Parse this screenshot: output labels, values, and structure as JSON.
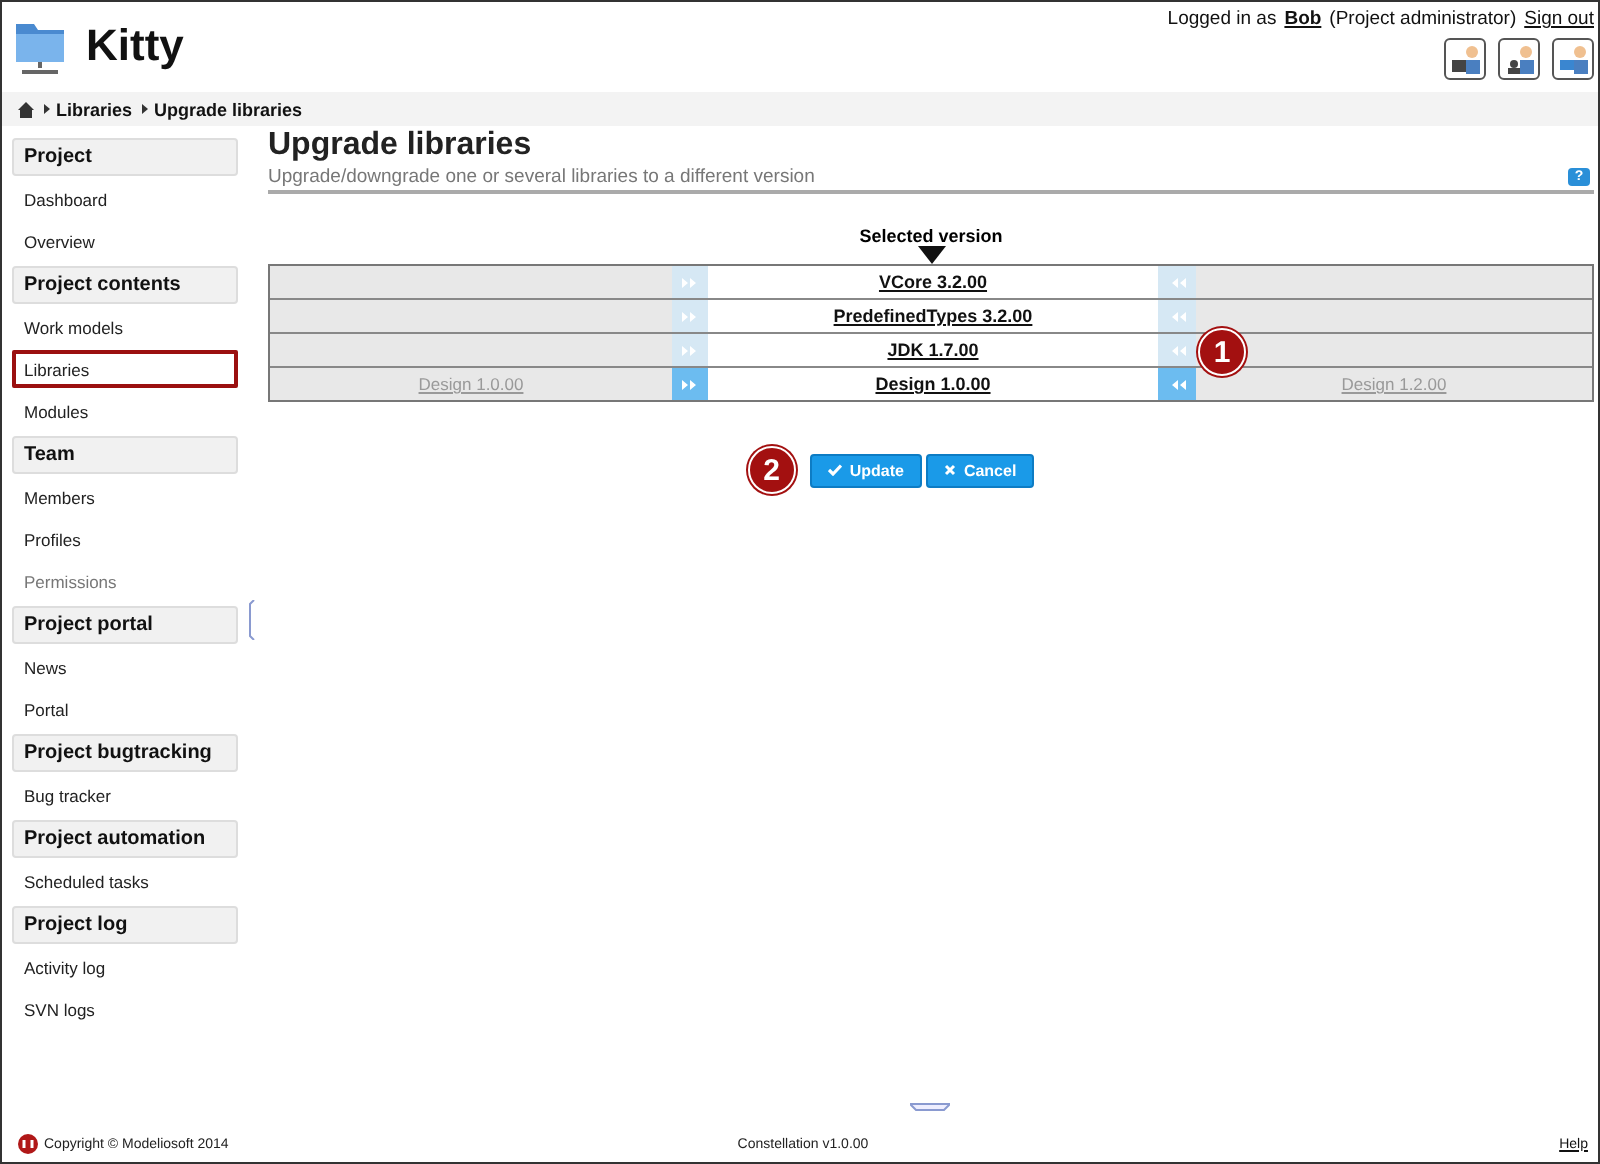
{
  "app": {
    "title": "Kitty"
  },
  "user": {
    "prefix": "Logged in as",
    "name": "Bob",
    "role": "(Project administrator)",
    "sign_out": "Sign out"
  },
  "breadcrumb": [
    "Libraries",
    "Upgrade libraries"
  ],
  "sidebar": [
    {
      "title": "Project",
      "items": [
        {
          "label": "Dashboard",
          "selected": false,
          "disabled": false
        },
        {
          "label": "Overview",
          "selected": false,
          "disabled": false
        }
      ]
    },
    {
      "title": "Project contents",
      "items": [
        {
          "label": "Work models",
          "selected": false,
          "disabled": false
        },
        {
          "label": "Libraries",
          "selected": true,
          "disabled": false
        },
        {
          "label": "Modules",
          "selected": false,
          "disabled": false
        }
      ]
    },
    {
      "title": "Team",
      "items": [
        {
          "label": "Members",
          "selected": false,
          "disabled": false
        },
        {
          "label": "Profiles",
          "selected": false,
          "disabled": false
        },
        {
          "label": "Permissions",
          "selected": false,
          "disabled": true
        }
      ]
    },
    {
      "title": "Project portal",
      "items": [
        {
          "label": "News",
          "selected": false,
          "disabled": false
        },
        {
          "label": "Portal",
          "selected": false,
          "disabled": false
        }
      ]
    },
    {
      "title": "Project bugtracking",
      "items": [
        {
          "label": "Bug tracker",
          "selected": false,
          "disabled": false
        }
      ]
    },
    {
      "title": "Project automation",
      "items": [
        {
          "label": "Scheduled tasks",
          "selected": false,
          "disabled": false
        }
      ]
    },
    {
      "title": "Project log",
      "items": [
        {
          "label": "Activity log",
          "selected": false,
          "disabled": false
        },
        {
          "label": "SVN logs",
          "selected": false,
          "disabled": false
        }
      ]
    }
  ],
  "page": {
    "title": "Upgrade libraries",
    "subtitle": "Upgrade/downgrade one or several libraries to a different version",
    "help": "?"
  },
  "selected_label": "Selected version",
  "libraries": [
    {
      "current": "VCore 3.2.00",
      "down_enabled": false,
      "up_enabled": false
    },
    {
      "current": "PredefinedTypes 3.2.00",
      "down_enabled": false,
      "up_enabled": false
    },
    {
      "current": "JDK 1.7.00",
      "down_enabled": false,
      "up_enabled": false
    },
    {
      "lower": "Design 1.0.00",
      "current": "Design 1.0.00",
      "upper": "Design 1.2.00",
      "down_enabled": true,
      "up_enabled": true
    }
  ],
  "markers": [
    "1",
    "2"
  ],
  "buttons": [
    {
      "label": "Update",
      "kind": "confirm"
    },
    {
      "label": "Cancel",
      "kind": "cancel"
    }
  ],
  "footer": {
    "copyright": "Copyright © Modeliosoft 2014",
    "version": "Constellation v1.0.00",
    "help": "Help"
  }
}
